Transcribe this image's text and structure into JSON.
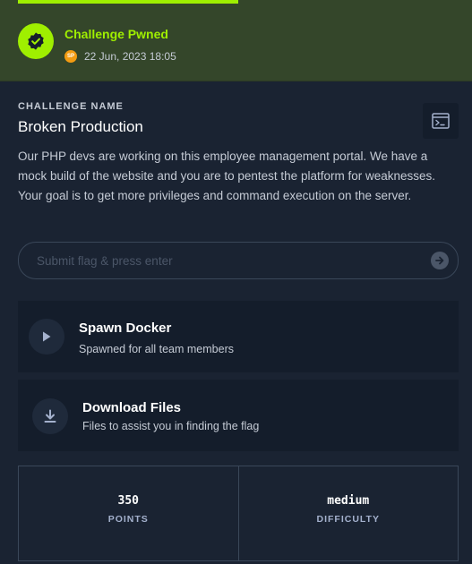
{
  "banner": {
    "status": "Challenge Pwned",
    "points_badge": "SP",
    "date": "22 Jun, 2023 18:05",
    "accent_color": "#9fef00"
  },
  "challenge": {
    "label": "CHALLENGE NAME",
    "name": "Broken Production",
    "description": "Our PHP devs are working on this employee management portal. We have a mock build of the website and you are to pentest the platform for weaknesses. Your goal is to get more privileges and command execution on the server.",
    "action_icon": "terminal-icon"
  },
  "flag": {
    "placeholder": "Submit flag & press enter",
    "value": "",
    "submit_icon": "arrow-right-icon"
  },
  "actions": [
    {
      "icon": "play-icon",
      "title": "Spawn Docker",
      "subtitle": "Spawned for all team members"
    },
    {
      "icon": "download-icon",
      "title": "Download Files",
      "subtitle": "Files to assist you in finding the flag"
    }
  ],
  "stats": [
    {
      "value": "350",
      "label": "POINTS"
    },
    {
      "value": "medium",
      "label": "DIFFICULTY"
    }
  ]
}
